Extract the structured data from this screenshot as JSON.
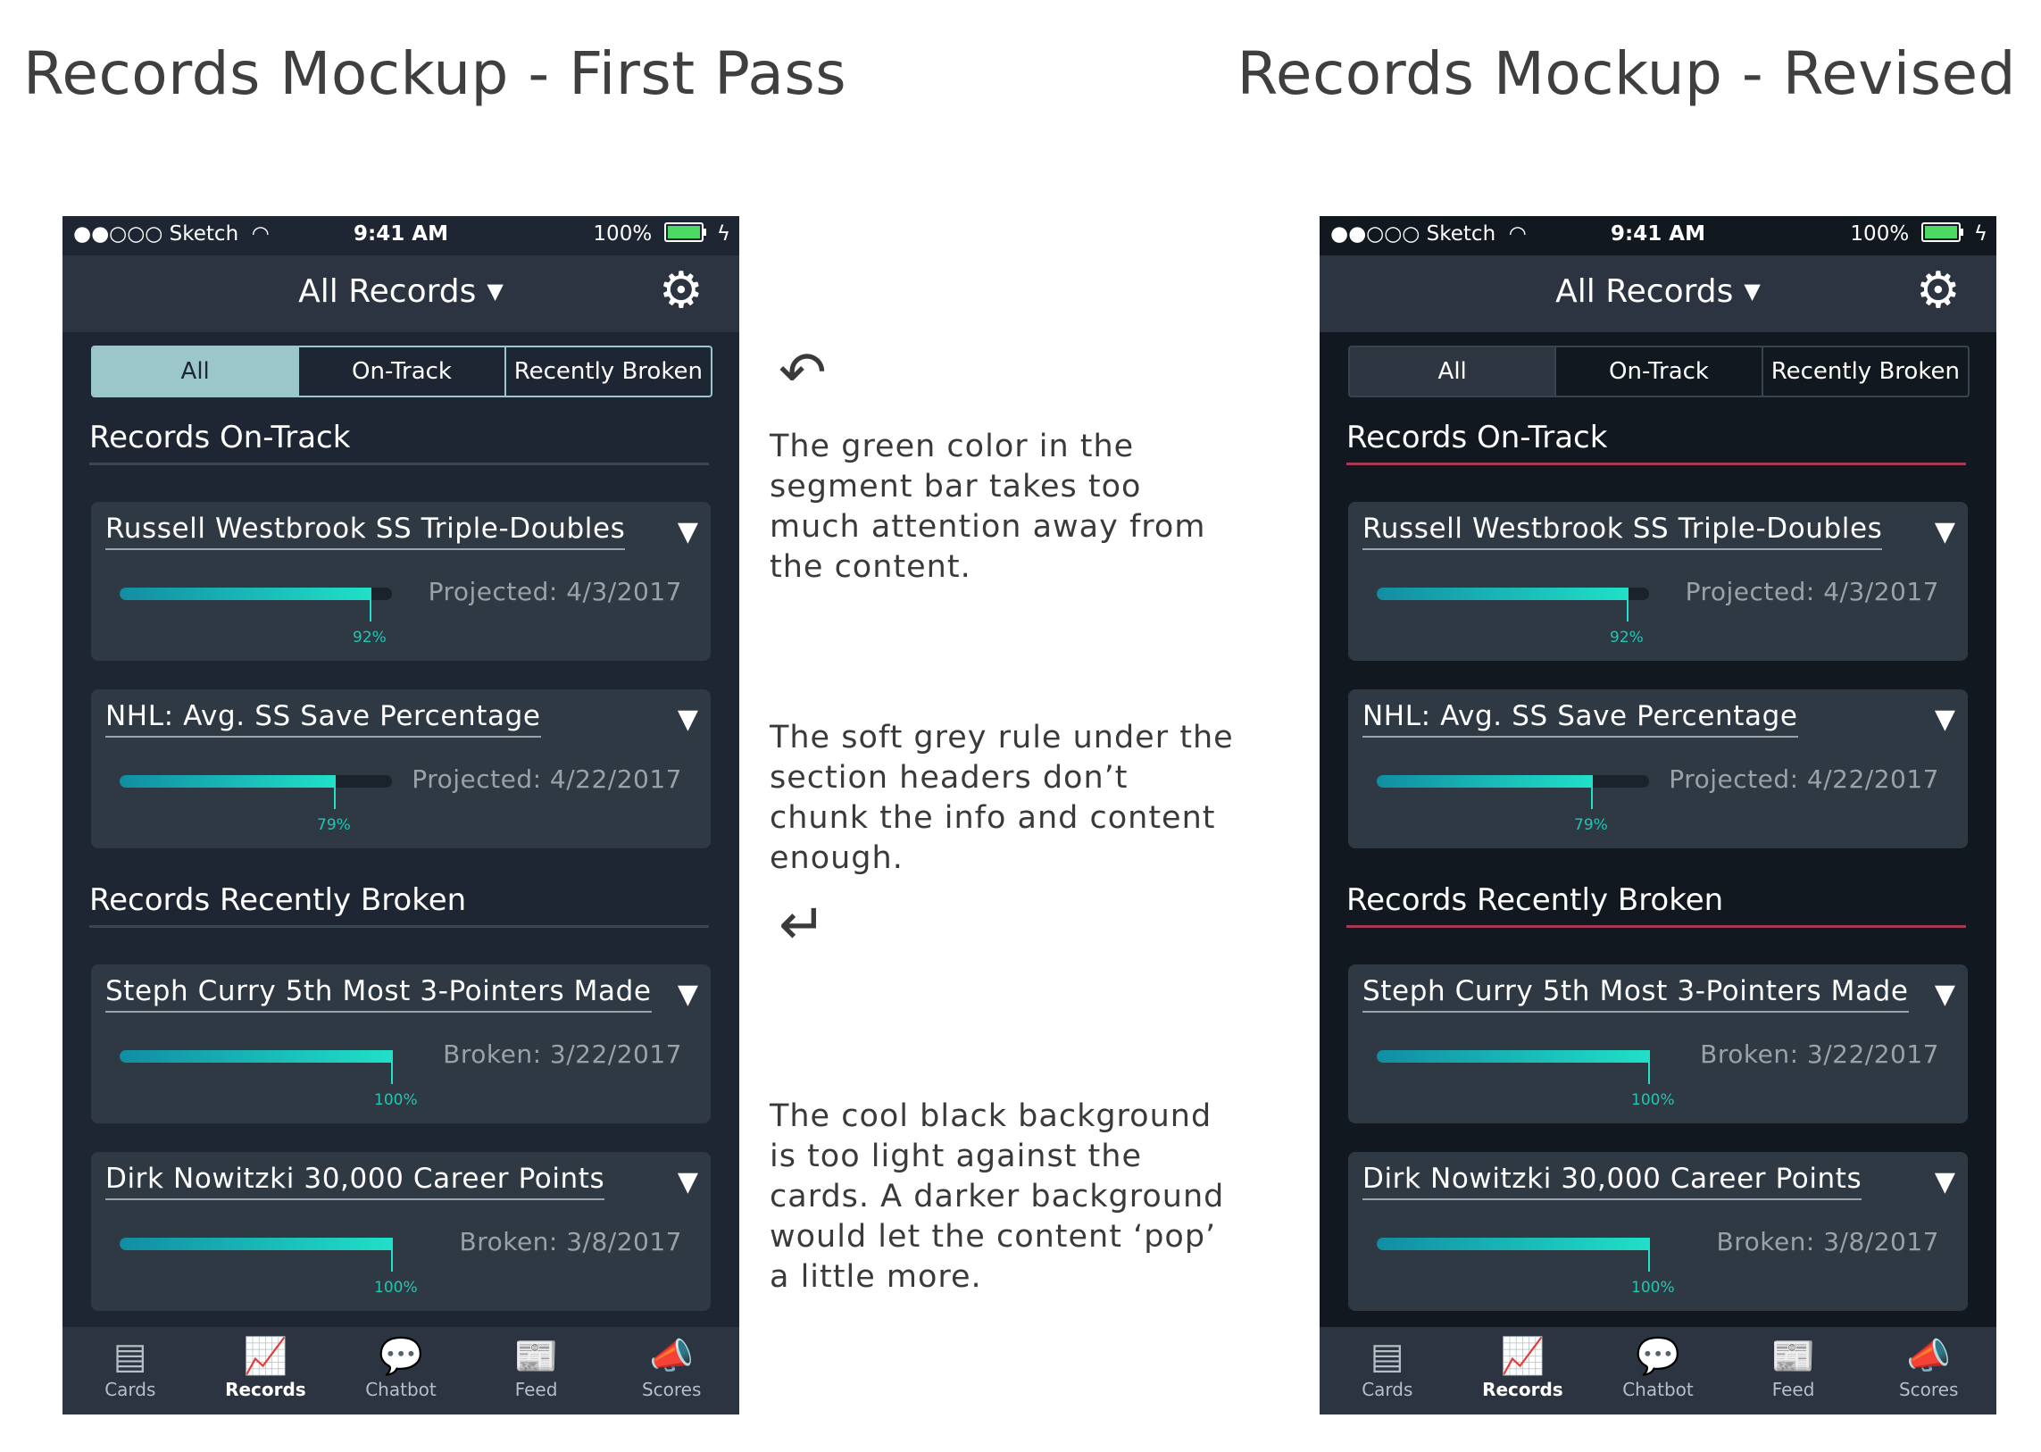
{
  "headings": {
    "left": "Records Mockup - First Pass",
    "right": "Records Mockup - Revised"
  },
  "phone": {
    "status": {
      "carrier": "●●○○○ Sketch",
      "wifi": "wifi-icon",
      "time": "9:41 AM",
      "battery": "100%"
    },
    "topbar": {
      "title": "All Records",
      "caret": "▼",
      "gear": "⚙"
    },
    "segments": [
      "All",
      "On-Track",
      "Recently Broken"
    ],
    "sections": [
      {
        "title": "Records On-Track"
      },
      {
        "title": "Records Recently Broken"
      }
    ],
    "cards": [
      {
        "title": "Russell Westbrook SS Triple-Doubles",
        "progress": 0.92,
        "pct": "92%",
        "date": "Projected: 4/3/2017"
      },
      {
        "title": "NHL: Avg. SS Save Percentage",
        "progress": 0.79,
        "pct": "79%",
        "date": "Projected: 4/22/2017"
      },
      {
        "title": "Steph Curry 5th Most 3-Pointers Made",
        "progress": 1.0,
        "pct": "100%",
        "date": "Broken: 3/22/2017"
      },
      {
        "title": "Dirk Nowitzki 30,000 Career Points",
        "progress": 1.0,
        "pct": "100%",
        "date": "Broken: 3/8/2017"
      }
    ],
    "tabs": [
      {
        "label": "Cards",
        "icon": "▤"
      },
      {
        "label": "Records",
        "icon": "📈"
      },
      {
        "label": "Chatbot",
        "icon": "💬"
      },
      {
        "label": "Feed",
        "icon": "📰"
      },
      {
        "label": "Scores",
        "icon": "📣"
      }
    ]
  },
  "notes": [
    "The green color in the segment bar takes too much attention away from the content.",
    "The soft grey rule under the section headers don’t chunk the info and content enough.",
    "The cool black background is too light against the cards.  A darker background would let the content ‘pop’ a little more."
  ],
  "colors": {
    "bg_first": "#1d2632",
    "bg_revised": "#111820",
    "segment_first": "#9bc7cb",
    "rule_first": "#3c4653",
    "rule_revised": "#a33b55",
    "progress": "#20e0c8"
  }
}
